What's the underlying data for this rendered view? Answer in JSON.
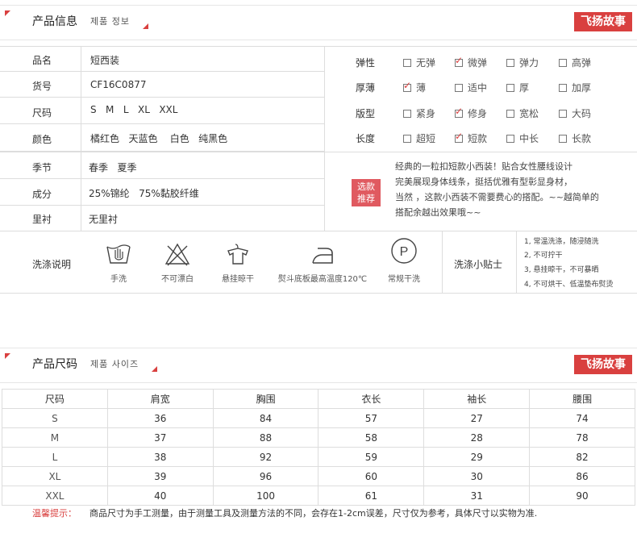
{
  "section1": {
    "title": "产品信息",
    "subtitle": "제품 정보",
    "brand": "飞扬故事"
  },
  "info_rows": [
    {
      "label": "品名",
      "value": "短西装"
    },
    {
      "label": "货号",
      "value": "CF16C0877"
    },
    {
      "label": "尺码",
      "value": "S   M   L   XL   XXL"
    },
    {
      "label": "颜色",
      "value": "橘红色   天蓝色    白色   纯黑色"
    },
    {
      "label": "季节",
      "value": "春季   夏季"
    },
    {
      "label": "成分",
      "value": "25%锦纶   75%黏胶纤维"
    },
    {
      "label": "里衬",
      "value": "无里衬"
    }
  ],
  "attributes": [
    {
      "label": "弹性",
      "options": [
        {
          "text": "无弹",
          "checked": false
        },
        {
          "text": "微弹",
          "checked": true
        },
        {
          "text": "弹力",
          "checked": false
        },
        {
          "text": "高弹",
          "checked": false
        }
      ]
    },
    {
      "label": "厚薄",
      "options": [
        {
          "text": "薄",
          "checked": true
        },
        {
          "text": "适中",
          "checked": false
        },
        {
          "text": "厚",
          "checked": false
        },
        {
          "text": "加厚",
          "checked": false
        }
      ]
    },
    {
      "label": "版型",
      "options": [
        {
          "text": "紧身",
          "checked": false
        },
        {
          "text": "修身",
          "checked": true
        },
        {
          "text": "宽松",
          "checked": false
        },
        {
          "text": "大码",
          "checked": false
        }
      ]
    },
    {
      "label": "长度",
      "options": [
        {
          "text": "超短",
          "checked": false
        },
        {
          "text": "短款",
          "checked": true
        },
        {
          "text": "中长",
          "checked": false
        },
        {
          "text": "长款",
          "checked": false
        }
      ]
    }
  ],
  "promo": {
    "badge_line1": "选款",
    "badge_line2": "推荐",
    "lines": [
      "经典的一粒扣短款小西装！贴合女性腰线设计",
      "完美展现身体线条，挺括优雅有型彰显身材，",
      "当然 ，这款小西装不需要费心的搭配。~~越简单的",
      "搭配余越出效果哦~~"
    ]
  },
  "wash": {
    "label": "洗涤说明",
    "icons": [
      {
        "name": "hand-wash-icon",
        "caption": "手洗"
      },
      {
        "name": "no-bleach-icon",
        "caption": "不可漂白"
      },
      {
        "name": "hang-dry-icon",
        "caption": "悬挂晾干"
      },
      {
        "name": "iron-icon",
        "caption": "熨斗底板最高温度120℃"
      },
      {
        "name": "dry-clean-icon",
        "caption": "常规干洗"
      }
    ],
    "tips_label": "洗涤小贴士",
    "tips": [
      "1, 常温洗涤，随浸随洗",
      "2, 不可拧干",
      "3, 悬挂晾干，不可暴晒",
      "4, 不可烘干、低温垫布熨烫"
    ]
  },
  "section2": {
    "title": "产品尺码",
    "subtitle": "제품 사이즈",
    "brand": "飞扬故事"
  },
  "size_table": {
    "headers": [
      "尺码",
      "肩宽",
      "胸围",
      "衣长",
      "袖长",
      "腰围"
    ],
    "rows": [
      [
        "S",
        "36",
        "84",
        "57",
        "27",
        "74"
      ],
      [
        "M",
        "37",
        "88",
        "58",
        "28",
        "78"
      ],
      [
        "L",
        "38",
        "92",
        "59",
        "29",
        "82"
      ],
      [
        "XL",
        "39",
        "96",
        "60",
        "30",
        "86"
      ],
      [
        "XXL",
        "40",
        "100",
        "61",
        "31",
        "90"
      ]
    ]
  },
  "note": {
    "label": "温馨提示：",
    "text": "商品尺寸为手工测量，由于测量工具及测量方法的不同，会存在1-2cm误差，尺寸仅为参考，具体尺寸以实物为准."
  },
  "colors": {
    "accent": "#d9403f",
    "border": "#dddddd"
  }
}
